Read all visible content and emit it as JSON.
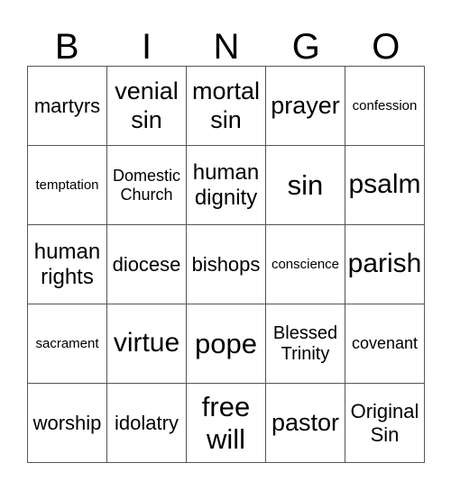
{
  "header": [
    "B",
    "I",
    "N",
    "G",
    "O"
  ],
  "rows": [
    [
      {
        "text": "martyrs",
        "size": "s22"
      },
      {
        "text": "venial sin",
        "size": "s26"
      },
      {
        "text": "mortal sin",
        "size": "s26"
      },
      {
        "text": "prayer",
        "size": "s26"
      },
      {
        "text": "confession",
        "size": "s15"
      }
    ],
    [
      {
        "text": "temptation",
        "size": "s15"
      },
      {
        "text": "Domestic Church",
        "size": "s18"
      },
      {
        "text": "human dignity",
        "size": "s24"
      },
      {
        "text": "sin",
        "size": "s31"
      },
      {
        "text": "psalm",
        "size": "s28"
      }
    ],
    [
      {
        "text": "human rights",
        "size": "s24"
      },
      {
        "text": "diocese",
        "size": "s22"
      },
      {
        "text": "bishops",
        "size": "s22"
      },
      {
        "text": "conscience",
        "size": "s15"
      },
      {
        "text": "parish",
        "size": "s28"
      }
    ],
    [
      {
        "text": "sacrament",
        "size": "s15"
      },
      {
        "text": "virtue",
        "size": "s28"
      },
      {
        "text": "pope",
        "size": "s31"
      },
      {
        "text": "Blessed Trinity",
        "size": "s20"
      },
      {
        "text": "covenant",
        "size": "s18"
      }
    ],
    [
      {
        "text": "worship",
        "size": "s22"
      },
      {
        "text": "idolatry",
        "size": "s22"
      },
      {
        "text": "free will",
        "size": "s31"
      },
      {
        "text": "pastor",
        "size": "s26"
      },
      {
        "text": "Original Sin",
        "size": "s22"
      }
    ]
  ]
}
